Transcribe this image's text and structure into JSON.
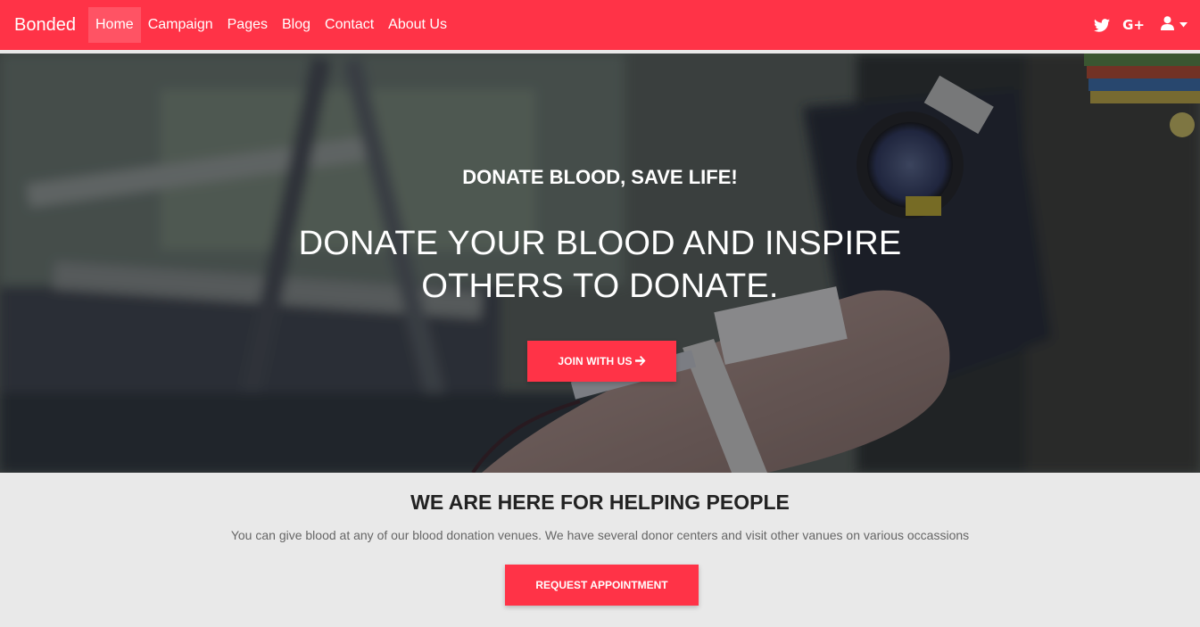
{
  "navbar": {
    "brand": "Bonded",
    "items": [
      {
        "label": "Home",
        "active": true
      },
      {
        "label": "Campaign"
      },
      {
        "label": "Pages"
      },
      {
        "label": "Blog"
      },
      {
        "label": "Contact"
      },
      {
        "label": "About Us"
      }
    ],
    "right_icons": [
      "twitter-icon",
      "google-plus-icon",
      "user-icon",
      "caret-down-icon"
    ],
    "google_plus_glyph": "G+"
  },
  "hero": {
    "kicker": "DONATE BLOOD, SAVE LIFE!",
    "title_line1": "DONATE YOUR BLOOD AND INSPIRE",
    "title_line2": "OTHERS TO DONATE.",
    "cta_label": "JOIN WITH US",
    "cta_icon": "arrow-right-icon",
    "background": "blurred photo of a blood donation: arm with tape and tube, blood pressure gauge"
  },
  "intro": {
    "title": "WE ARE HERE FOR HELPING PEOPLE",
    "text": "You can give blood at any of our blood donation venues. We have several donor centers and visit other vanues on various occassions",
    "cta_label": "REQUEST APPOINTMENT"
  },
  "colors": {
    "accent": "#ff3347",
    "section_bg": "#e9e9e9"
  }
}
